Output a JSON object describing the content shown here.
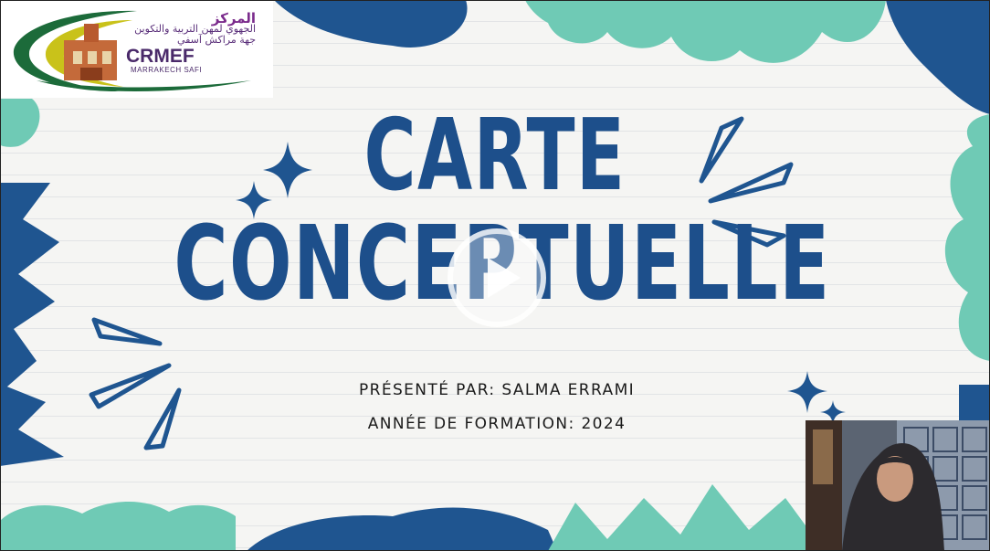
{
  "slide": {
    "title_line1": "CARTE",
    "title_line2": "CONCEPTUELLE",
    "presenter_line": "PRÉSENTÉ PAR: SALMA ERRAMI",
    "year_line": "ANNÉE DE FORMATION: 2024"
  },
  "logo": {
    "arabic_line1": "المركز",
    "arabic_line2": "الجهوي لمهن التربية والتكوين",
    "arabic_line3": "جهة مراكش آسفي",
    "name": "CRMEF",
    "subtitle": "MARRAKECH SAFI"
  },
  "video": {
    "play_icon": "play-icon"
  },
  "colors": {
    "title_blue": "#1d4f8b",
    "dark_blue": "#1f5590",
    "teal": "#5ec7b1",
    "text_dark": "#1a1a1a"
  }
}
